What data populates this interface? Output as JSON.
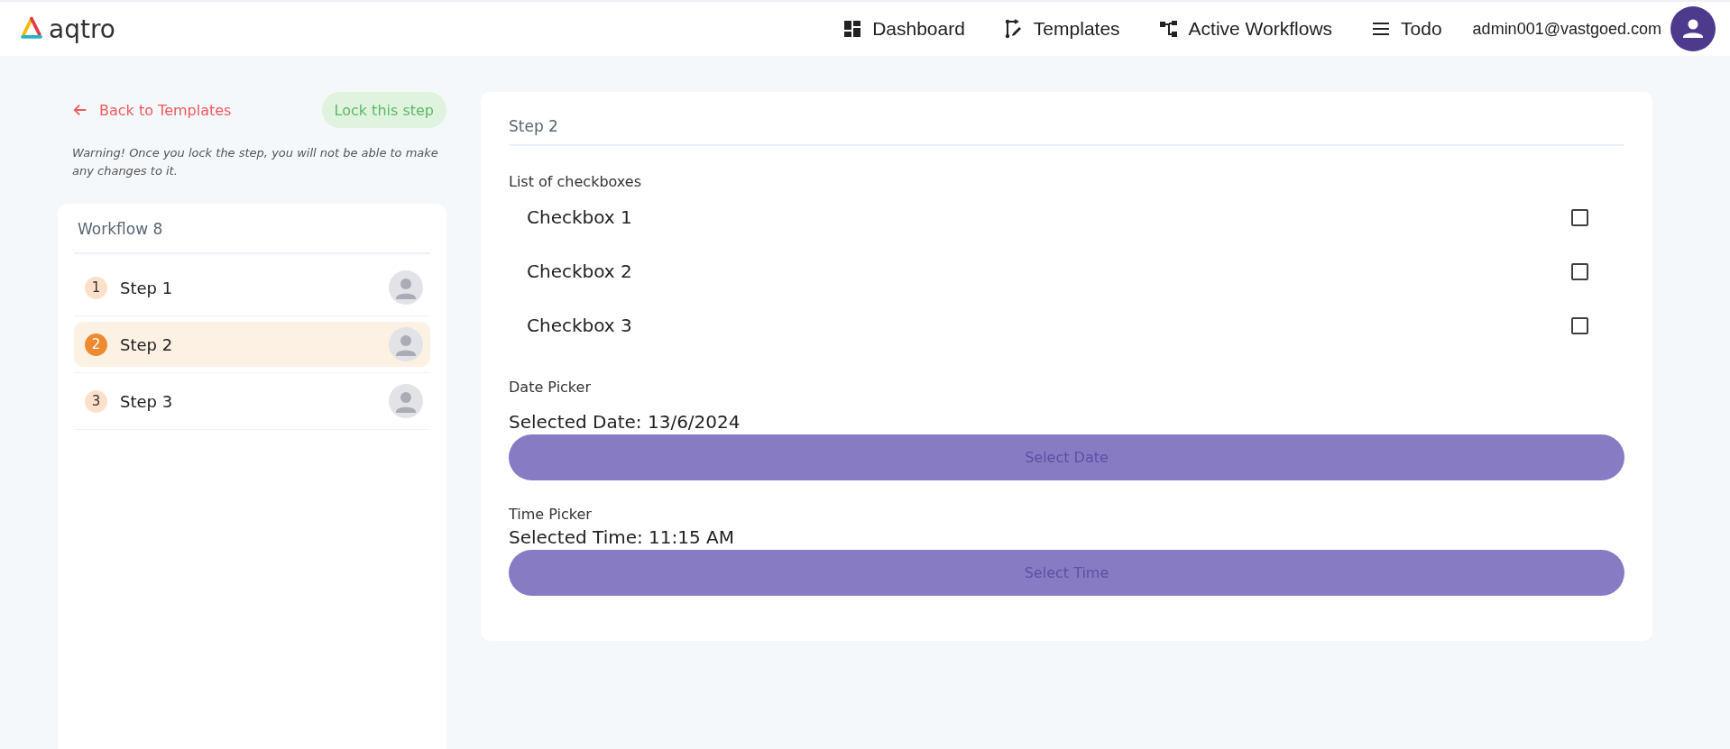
{
  "header": {
    "logo": "aqtro",
    "nav": [
      {
        "label": "Dashboard"
      },
      {
        "label": "Templates"
      },
      {
        "label": "Active Workflows"
      },
      {
        "label": "Todo"
      }
    ],
    "user": "admin001@vastgoed.com"
  },
  "sidebar": {
    "back": "Back to Templates",
    "lock_button": "Lock this step",
    "warning": "Warning! Once you lock the step, you will not be able to make any changes to it.",
    "workflow_title": "Workflow 8",
    "steps": [
      {
        "number": "1",
        "label": "Step 1",
        "selected": false
      },
      {
        "number": "2",
        "label": "Step 2",
        "selected": true
      },
      {
        "number": "3",
        "label": "Step 3",
        "selected": false
      }
    ]
  },
  "step": {
    "title": "Step 2",
    "checklist_label": "List of checkboxes",
    "checkboxes": [
      {
        "label": "Checkbox 1",
        "checked": false
      },
      {
        "label": "Checkbox 2",
        "checked": false
      },
      {
        "label": "Checkbox 3",
        "checked": false
      }
    ],
    "date_label": "Date Picker",
    "date_value": "Selected Date: 13/6/2024",
    "date_button": "Select Date",
    "time_label": "Time Picker",
    "time_value": "Selected Time: 11:15 AM",
    "time_button": "Select Time"
  }
}
